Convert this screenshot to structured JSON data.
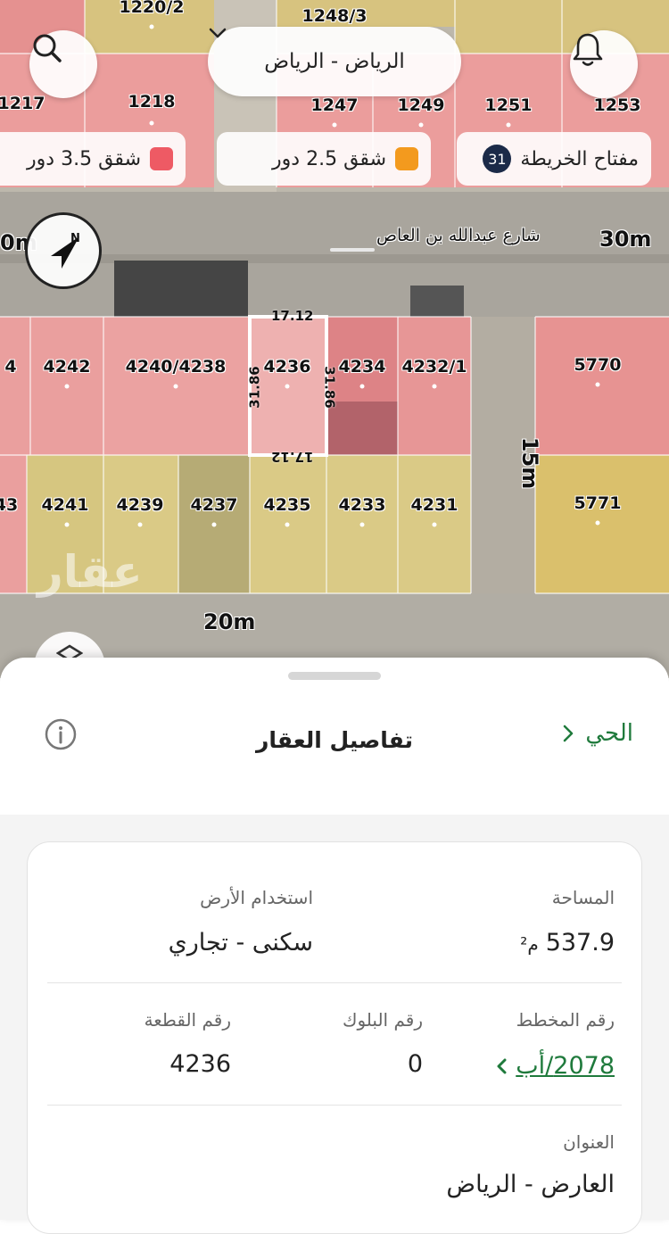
{
  "map": {
    "plots_top": [
      "1220/2",
      "1248/3",
      "1217",
      "1218",
      "1247",
      "1249",
      "1251",
      "1253"
    ],
    "plots_middle": [
      "4242",
      "4240/4238",
      "4236",
      "4234",
      "4232/1",
      "5770"
    ],
    "plots_bottom": [
      "43",
      "4241",
      "4239",
      "4237",
      "4235",
      "4233",
      "4231",
      "5771"
    ],
    "partial_left_middle": "4",
    "street_top_width": "30m",
    "street_top_width_left": "0m",
    "street_top_name": "شارع عبدالله بن العاص",
    "street_side_width": "15m",
    "street_bottom_width": "20m",
    "selected_plot": {
      "top": "17.12",
      "bottom": "17.12",
      "left": "31.86",
      "right": "31.86"
    },
    "watermark": "عقار",
    "compass_letter": "N"
  },
  "header": {
    "city_selector": "الرياض - الرياض",
    "search_icon": "search-icon",
    "bell_icon": "bell-icon"
  },
  "legend": {
    "key_label": "مفتاح الخريطة",
    "key_count": "31",
    "item_2_5": {
      "label": "شقق 2.5 دور",
      "color": "#f39a1e"
    },
    "item_3_5": {
      "label": "شقق 3.5 دور",
      "color": "#ee5a64"
    }
  },
  "sheet": {
    "title": "تفاصيل العقار",
    "neighborhood_link": "الحي",
    "area_label": "المساحة",
    "area_value": "537.9",
    "area_unit": "م²",
    "land_use_label": "استخدام الأرض",
    "land_use_value": "سكنى - تجاري",
    "plan_label": "رقم المخطط",
    "plan_value": "2078/أب",
    "block_label": "رقم البلوك",
    "block_value": "0",
    "plot_label": "رقم القطعة",
    "plot_value": "4236",
    "address_label": "العنوان",
    "address_value": "العارض - الرياض"
  },
  "colors": {
    "accent_green": "#1f7a3c",
    "residential_commercial": "#f08a8a",
    "residential": "#e8cf6e"
  }
}
